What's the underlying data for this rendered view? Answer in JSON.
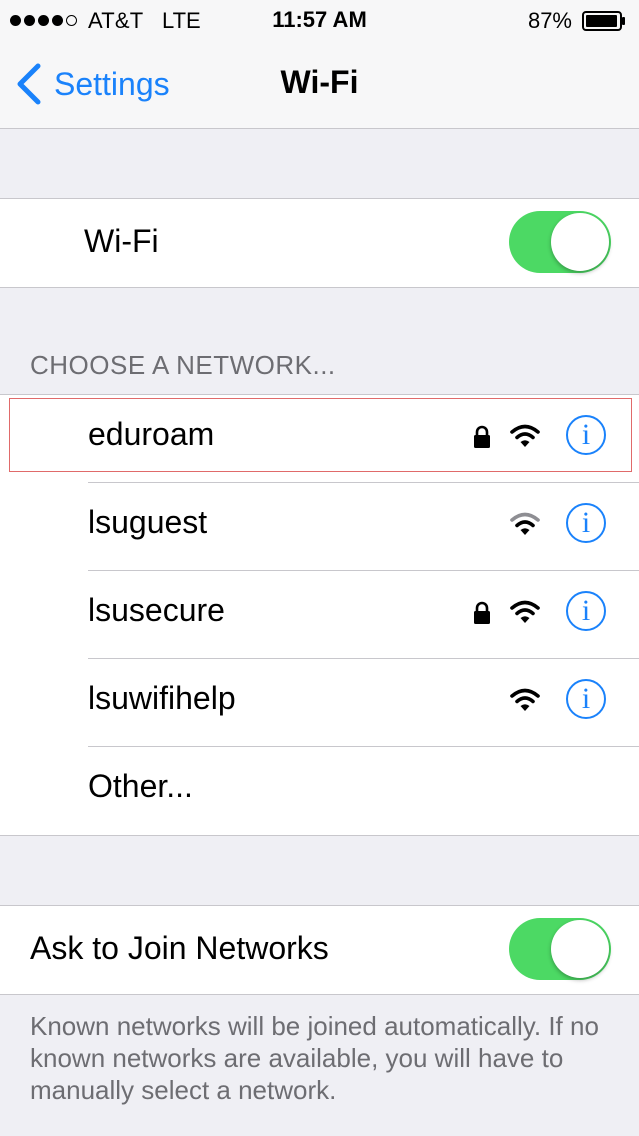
{
  "status_bar": {
    "carrier": "AT&T",
    "network_type": "LTE",
    "time": "11:57 AM",
    "battery_percent": "87%",
    "signal_bars_filled": 4,
    "signal_bars_total": 5
  },
  "nav": {
    "back_label": "Settings",
    "title": "Wi-Fi"
  },
  "wifi_toggle": {
    "label": "Wi-Fi",
    "on": true
  },
  "networks_section": {
    "header": "CHOOSE A NETWORK...",
    "networks": [
      {
        "name": "eduroam",
        "secured": true,
        "signal": "full",
        "highlighted": true
      },
      {
        "name": "lsuguest",
        "secured": false,
        "signal": "medium",
        "highlighted": false
      },
      {
        "name": "lsusecure",
        "secured": true,
        "signal": "full",
        "highlighted": false
      },
      {
        "name": "lsuwifihelp",
        "secured": false,
        "signal": "full",
        "highlighted": false
      }
    ],
    "other_label": "Other..."
  },
  "ask_to_join": {
    "label": "Ask to Join Networks",
    "on": true,
    "footer": "Known networks will be joined automatically. If no known networks are available, you will have to manually select a network."
  },
  "colors": {
    "accent_blue": "#1a82fb",
    "toggle_green": "#4cd964",
    "background": "#efeff4",
    "highlight_red": "#e06a6a"
  },
  "icons": {
    "lock": "lock-icon",
    "wifi": "wifi-icon",
    "info": "info-icon",
    "back": "chevron-left-icon",
    "battery": "battery-icon"
  }
}
